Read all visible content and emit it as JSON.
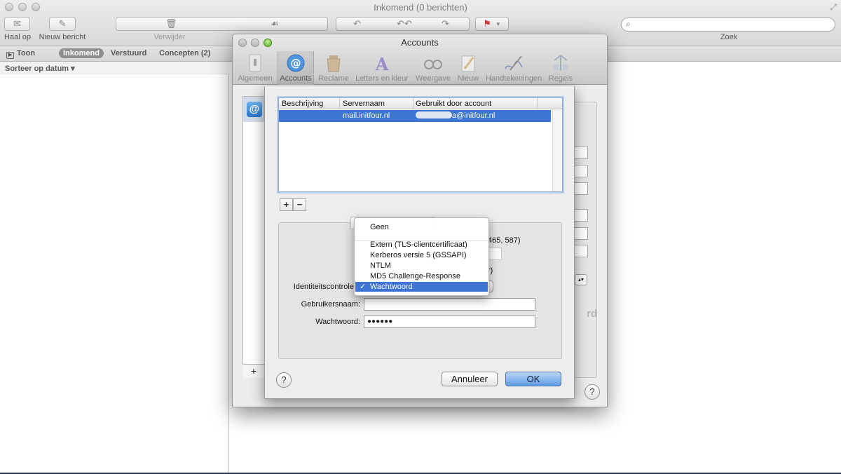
{
  "window": {
    "title": "Inkomend (0 berichten)"
  },
  "toolbar": {
    "get_mail": "Haal op",
    "new_message": "Nieuw bericht",
    "delete": "Verwijder",
    "search_label": "Zoek",
    "search_placeholder": ""
  },
  "favorites": {
    "show": "Toon",
    "inbox": "Inkomend",
    "sent": "Verstuurd",
    "drafts": "Concepten (2)"
  },
  "sort": {
    "label": "Sorteer op datum ▾"
  },
  "prefs": {
    "title": "Accounts",
    "tabs": [
      {
        "label": "Algemeen"
      },
      {
        "label": "Accounts"
      },
      {
        "label": "Reclame"
      },
      {
        "label": "Letters en kleur"
      },
      {
        "label": "Weergave"
      },
      {
        "label": "Nieuw"
      },
      {
        "label": "Handtekeningen"
      },
      {
        "label": "Regels"
      }
    ],
    "add_account": "+",
    "help": "?",
    "ghost_fragment": "rd"
  },
  "sheet": {
    "columns": {
      "description": "Beschrijving",
      "server": "Servernaam",
      "used_by": "Gebruikt door account"
    },
    "rows": [
      {
        "description": "",
        "server": "mail.initfour.nl",
        "used_by_suffix": "a@initfour.nl"
      }
    ],
    "add": "+",
    "remove": "−",
    "ports_fragment": "465, 587)",
    "paren_fragment": "r)",
    "auth_label": "Identiteitscontrole:",
    "username_label": "Gebruikersnaam:",
    "username_value": "",
    "password_label": "Wachtwoord:",
    "password_value": "●●●●●●",
    "help": "?",
    "cancel": "Annuleer",
    "ok": "OK"
  },
  "auth_menu": {
    "items": [
      {
        "label": "Geen"
      },
      {
        "label": "Extern (TLS-clientcertificaat)"
      },
      {
        "label": "Kerberos versie 5 (GSSAPI)"
      },
      {
        "label": "NTLM"
      },
      {
        "label": "MD5 Challenge-Response"
      },
      {
        "label": "Wachtwoord",
        "check": "✓"
      }
    ]
  },
  "colors": {
    "selection": "#3e74d6",
    "ok_button": "#5f9be2"
  }
}
